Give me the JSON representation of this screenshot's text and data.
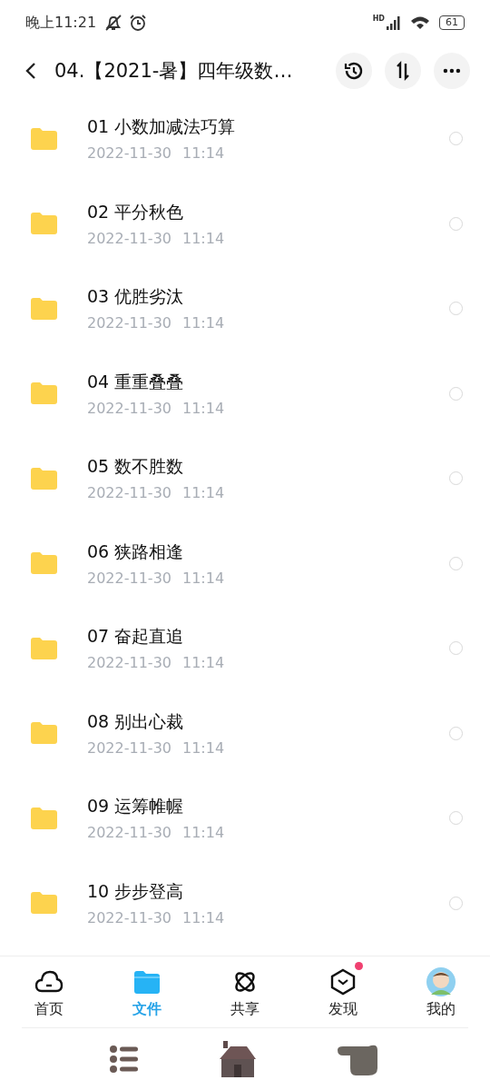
{
  "status_bar": {
    "time": "晚上11:21",
    "network": "HD",
    "battery": "61"
  },
  "header": {
    "title": "04.【2021-暑】四年级数…"
  },
  "files": [
    {
      "name": "01 小数加减法巧算",
      "date": "2022-11-30",
      "time": "11:14",
      "selected": false
    },
    {
      "name": "02 平分秋色",
      "date": "2022-11-30",
      "time": "11:14",
      "selected": false
    },
    {
      "name": "03 优胜劣汰",
      "date": "2022-11-30",
      "time": "11:14",
      "selected": false
    },
    {
      "name": "04 重重叠叠",
      "date": "2022-11-30",
      "time": "11:14",
      "selected": false
    },
    {
      "name": "05 数不胜数",
      "date": "2022-11-30",
      "time": "11:14",
      "selected": false
    },
    {
      "name": "06 狭路相逢",
      "date": "2022-11-30",
      "time": "11:14",
      "selected": false
    },
    {
      "name": "07 奋起直追",
      "date": "2022-11-30",
      "time": "11:14",
      "selected": false
    },
    {
      "name": "08 别出心裁",
      "date": "2022-11-30",
      "time": "11:14",
      "selected": false
    },
    {
      "name": "09 运筹帷幄",
      "date": "2022-11-30",
      "time": "11:14",
      "selected": false
    },
    {
      "name": "10 步步登高",
      "date": "2022-11-30",
      "time": "11:14",
      "selected": false
    }
  ],
  "nav": [
    {
      "kind": "cloud",
      "label": "首页",
      "selected": false,
      "badge": false
    },
    {
      "kind": "folder",
      "label": "文件",
      "selected": true,
      "badge": false
    },
    {
      "kind": "atom",
      "label": "共享",
      "selected": false,
      "badge": false
    },
    {
      "kind": "hexagon",
      "label": "发现",
      "selected": false,
      "badge": true
    },
    {
      "kind": "avatar",
      "label": "我的",
      "selected": false,
      "badge": false
    }
  ]
}
